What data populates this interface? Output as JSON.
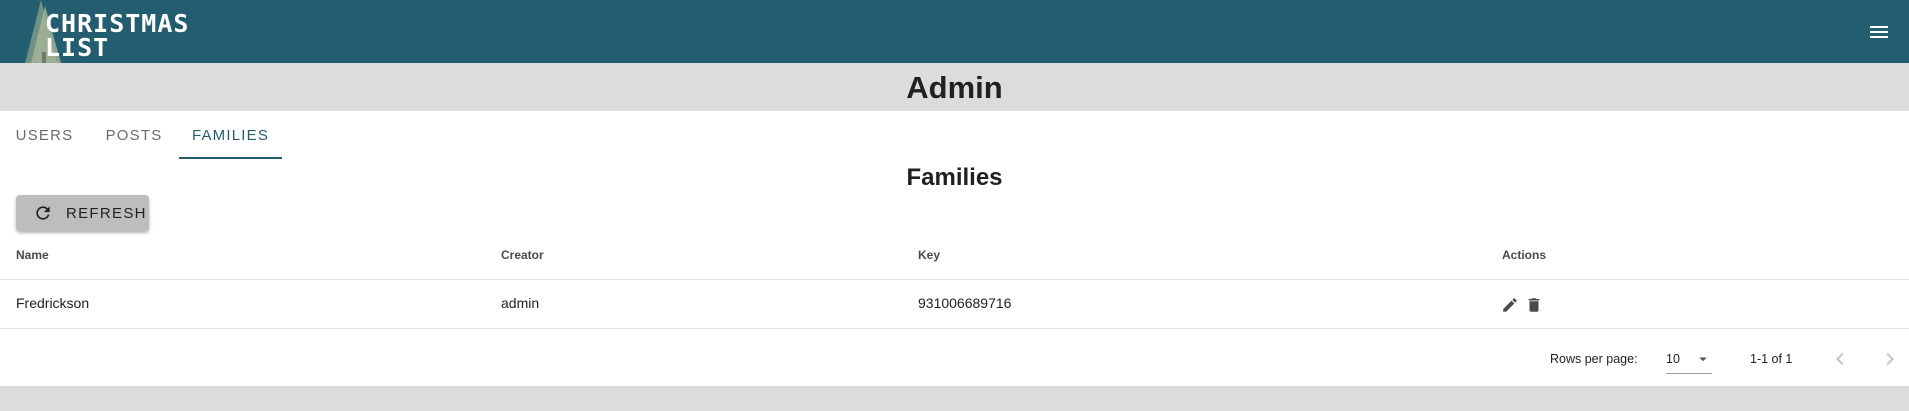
{
  "app": {
    "logo_line1": "CHRISTMAS",
    "logo_line2": "LIST",
    "menu_icon": "hamburger-menu-icon",
    "brand_color": "#225e70"
  },
  "page": {
    "title": "Admin"
  },
  "tabs": [
    {
      "label": "USERS",
      "active": false
    },
    {
      "label": "POSTS",
      "active": false
    },
    {
      "label": "FAMILIES",
      "active": true
    }
  ],
  "section": {
    "title": "Families"
  },
  "refresh_button": {
    "label": "REFRESH",
    "icon": "refresh-icon"
  },
  "table": {
    "columns": [
      "Name",
      "Creator",
      "Key",
      "Actions"
    ],
    "rows": [
      {
        "name": "Fredrickson",
        "creator": "admin",
        "key": "931006689716",
        "actions": [
          "edit-icon",
          "delete-icon"
        ]
      }
    ]
  },
  "pagination": {
    "rows_per_page_label": "Rows per page:",
    "rows_per_page_value": "10",
    "range_text": "1-1 of 1"
  }
}
